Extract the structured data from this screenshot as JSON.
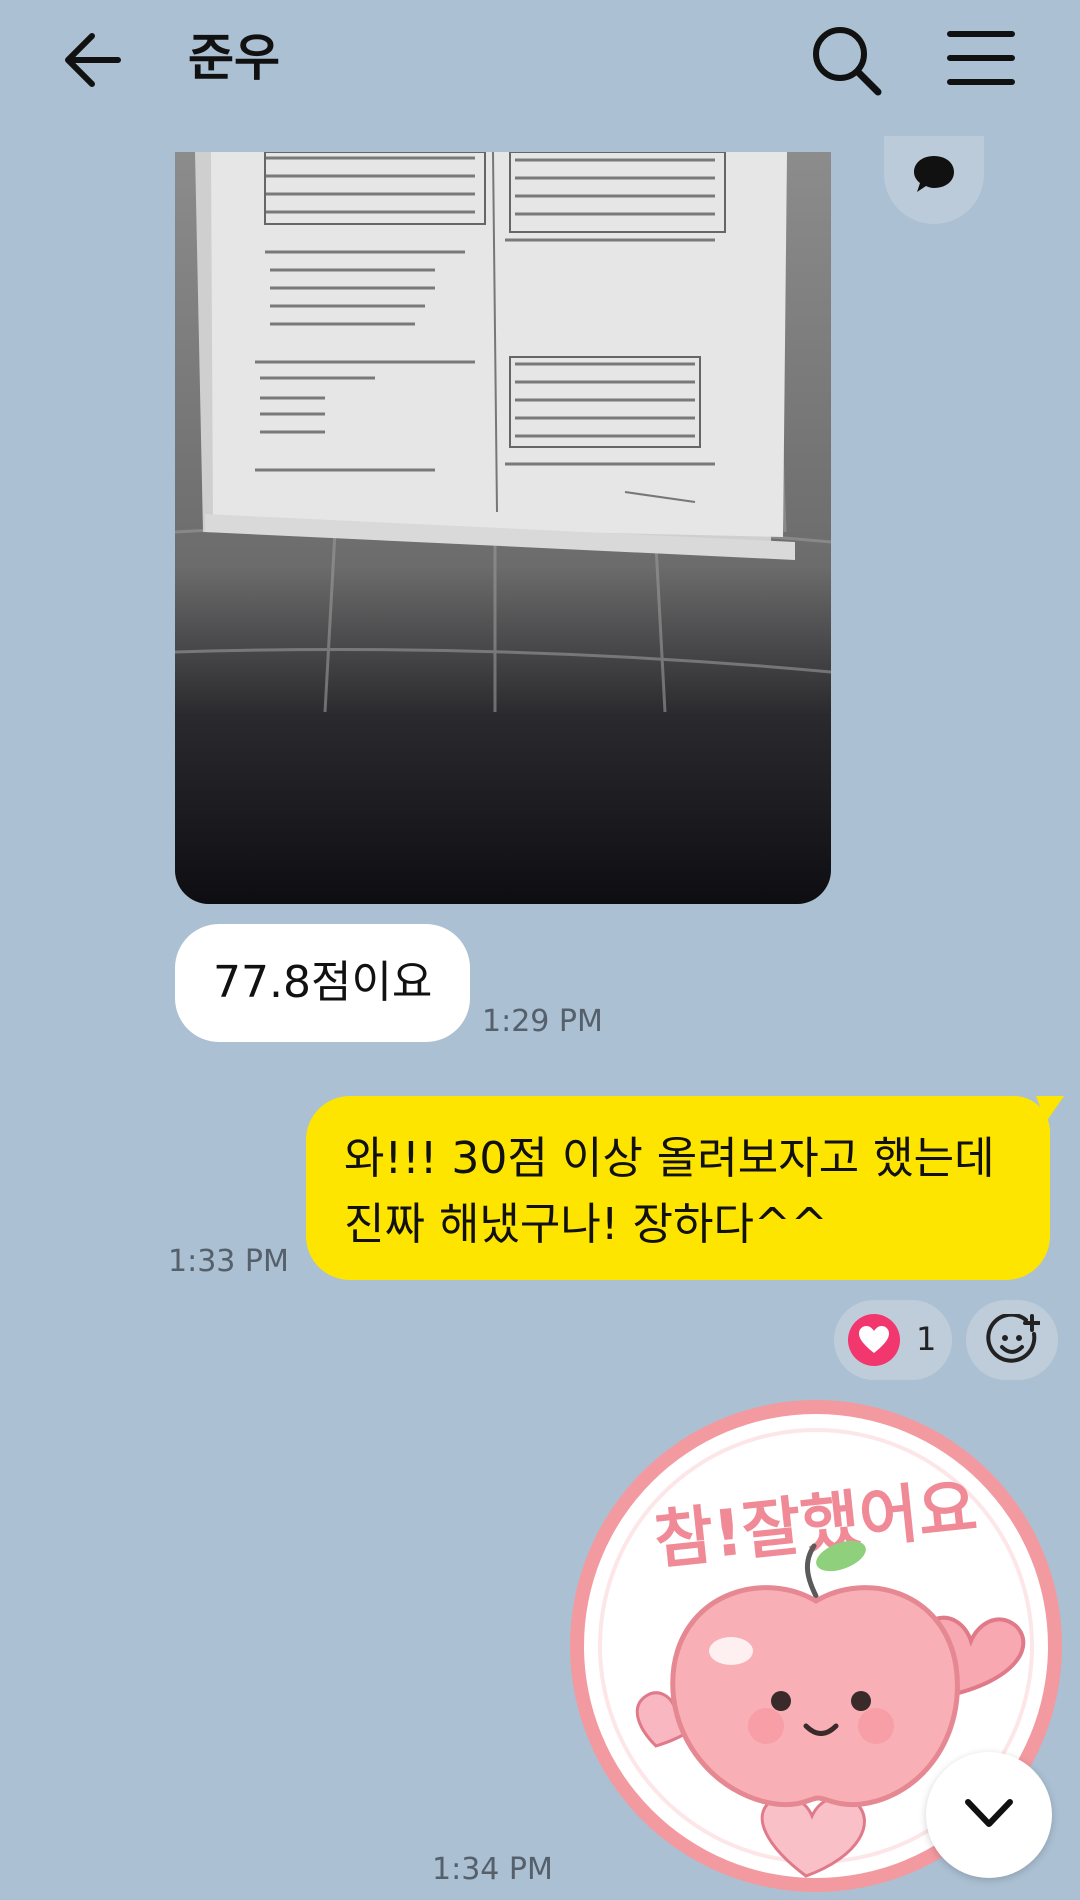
{
  "header": {
    "title": "준우",
    "back_icon": "arrow-left-icon",
    "search_icon": "search-icon",
    "menu_icon": "hamburger-menu-icon"
  },
  "messages": [
    {
      "type": "photo",
      "direction": "received",
      "description_icon": "comment-icon"
    },
    {
      "type": "text",
      "direction": "received",
      "text": "77.8점이요",
      "time": "1:29 PM"
    },
    {
      "type": "text",
      "direction": "sent",
      "lines": [
        "와!!! 30점 이상 올려보자고 했는데",
        "진짜 해냈구나! 장하다^^"
      ],
      "time": "1:33 PM",
      "reaction": {
        "icon": "heart-icon",
        "count": "1"
      },
      "add_reaction_icon": "add-emoji-icon"
    },
    {
      "type": "sticker",
      "direction": "sent",
      "sticker_text": "참!잘했어요",
      "time": "1:34 PM"
    }
  ],
  "scroll_down_icon": "chevron-down-icon",
  "colors": {
    "background": "#abc0d3",
    "sent_bubble": "#fee500",
    "received_bubble": "#ffffff",
    "reaction_heart": "#f2366e"
  }
}
